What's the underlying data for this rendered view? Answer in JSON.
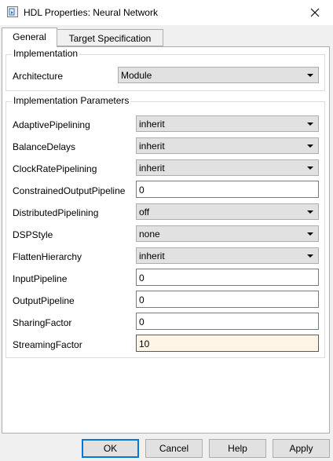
{
  "window": {
    "title": "HDL Properties: Neural Network"
  },
  "tabs": [
    {
      "label": "General",
      "active": true
    },
    {
      "label": "Target Specification",
      "active": false
    }
  ],
  "implementation": {
    "group_title": "Implementation",
    "architecture_label": "Architecture",
    "architecture_value": "Module"
  },
  "params": {
    "group_title": "Implementation Parameters",
    "rows": [
      {
        "label": "AdaptivePipelining",
        "value": "inherit",
        "control": "dropdown"
      },
      {
        "label": "BalanceDelays",
        "value": "inherit",
        "control": "dropdown"
      },
      {
        "label": "ClockRatePipelining",
        "value": "inherit",
        "control": "dropdown"
      },
      {
        "label": "ConstrainedOutputPipeline",
        "value": "0",
        "control": "text"
      },
      {
        "label": "DistributedPipelining",
        "value": "off",
        "control": "dropdown"
      },
      {
        "label": "DSPStyle",
        "value": "none",
        "control": "dropdown"
      },
      {
        "label": "FlattenHierarchy",
        "value": "inherit",
        "control": "dropdown"
      },
      {
        "label": "InputPipeline",
        "value": "0",
        "control": "text"
      },
      {
        "label": "OutputPipeline",
        "value": "0",
        "control": "text"
      },
      {
        "label": "SharingFactor",
        "value": "0",
        "control": "text"
      },
      {
        "label": "StreamingFactor",
        "value": "10",
        "control": "text",
        "focused": true
      }
    ]
  },
  "buttons": {
    "ok": "OK",
    "cancel": "Cancel",
    "help": "Help",
    "apply": "Apply"
  },
  "icons": {
    "app": "simulink-block-icon",
    "close": "close-icon",
    "dropdown": "chevron-down-icon"
  },
  "colors": {
    "focus_border": "#0078d7",
    "focused_field_bg": "#fff5e6"
  }
}
